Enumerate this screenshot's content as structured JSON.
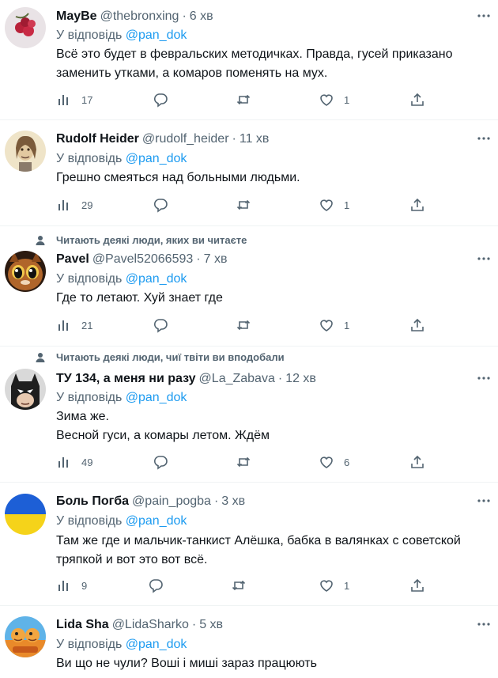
{
  "reply_prefix": "У відповідь",
  "tweets": [
    {
      "name": "MayBe",
      "handle": "@thebronxing",
      "time": "6 хв",
      "reply_to": "@pan_dok",
      "lines": [
        "Всё это будет в февральских методичках. Правда, гусей приказано",
        "заменить утками, а комаров поменять на мух."
      ],
      "views": "17",
      "replies": "",
      "retweets": "",
      "likes": "1"
    },
    {
      "name": "Rudolf Heider",
      "handle": "@rudolf_heider",
      "time": "11 хв",
      "reply_to": "@pan_dok",
      "lines": [
        "Грешно смеяться над больными людьми."
      ],
      "views": "29",
      "replies": "",
      "retweets": "",
      "likes": "1"
    },
    {
      "social_context": "Читають деякі люди, яких ви читаєте",
      "name": "Pavel",
      "handle": "@Pavel52066593",
      "time": "7 хв",
      "reply_to": "@pan_dok",
      "lines": [
        "Где то летают. Хуй знает где"
      ],
      "views": "21",
      "replies": "",
      "retweets": "",
      "likes": "1"
    },
    {
      "social_context": "Читають деякі люди, чиї твіти ви вподобали",
      "name": "ТУ 134, а меня ни разу",
      "handle": "@La_Zabava",
      "time": "12 хв",
      "reply_to": "@pan_dok",
      "lines": [
        "Зима же.",
        "Весной гуси, а комары летом. Ждём"
      ],
      "views": "49",
      "replies": "",
      "retweets": "",
      "likes": "6"
    },
    {
      "name": "Боль Погба",
      "handle": "@pain_pogba",
      "time": "3 хв",
      "reply_to": "@pan_dok",
      "lines": [
        "Там же где и мальчик-танкист Алёшка, бабка в валянках с советской",
        "тряпкой и вот это вот всё."
      ],
      "views": "9",
      "replies": "",
      "retweets": "",
      "likes": "1"
    },
    {
      "name": "Lida Sha",
      "handle": "@LidaSharko",
      "time": "5 хв",
      "reply_to": "@pan_dok",
      "lines": [
        "Ви що не чули? Воші і миші зараз працюють"
      ]
    }
  ],
  "colors": {
    "text": "#0f1419",
    "secondary": "#536471",
    "link": "#1d9bf0",
    "divider": "#eff3f4",
    "flag_blue": "#1d5fd6",
    "flag_yellow": "#f5d31a"
  },
  "icons": [
    "views-icon",
    "reply-icon",
    "retweet-icon",
    "like-icon",
    "share-icon",
    "more-icon",
    "person-icon"
  ]
}
